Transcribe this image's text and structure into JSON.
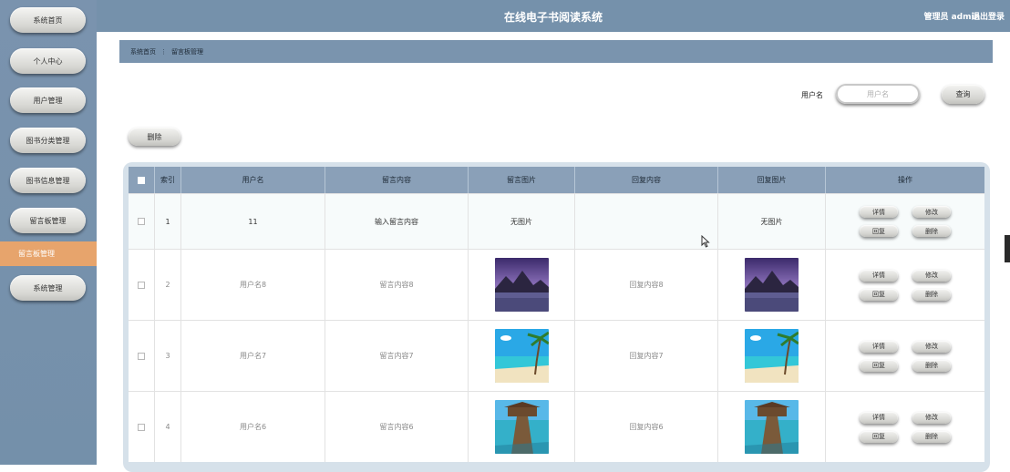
{
  "app": {
    "title": "在线电子书阅读系统",
    "user_info": "管理员 admin",
    "logout_label": "退出登录"
  },
  "sidebar": {
    "items": [
      {
        "label": "系统首页"
      },
      {
        "label": "个人中心"
      },
      {
        "label": "用户管理"
      },
      {
        "label": "图书分类管理"
      },
      {
        "label": "图书信息管理"
      },
      {
        "label": "留言板管理"
      },
      {
        "label": "留言板管理",
        "active": true
      },
      {
        "label": "系统管理"
      }
    ],
    "active_color": "#e7a46c"
  },
  "breadcrumb": {
    "home": "系统首页",
    "separator": "⋮",
    "current": "留言板管理"
  },
  "search": {
    "label": "用户名",
    "placeholder": "用户名",
    "value": "",
    "button_label": "查询"
  },
  "toolbar": {
    "delete_label": "删除"
  },
  "table": {
    "columns": [
      "",
      "索引",
      "用户名",
      "留言内容",
      "留言图片",
      "回复内容",
      "回复图片",
      "操作"
    ],
    "rows": [
      {
        "index": "1",
        "username": "11",
        "content": "输入留言内容",
        "image": "无图片",
        "reply": "",
        "reply_image": "无图片"
      },
      {
        "index": "2",
        "username": "用户名8",
        "content": "留言内容8",
        "image_kind": "lake",
        "reply": "回复内容8",
        "reply_image_kind": "lake"
      },
      {
        "index": "3",
        "username": "用户名7",
        "content": "留言内容7",
        "image_kind": "beach",
        "reply": "回复内容7",
        "reply_image_kind": "beach"
      },
      {
        "index": "4",
        "username": "用户名6",
        "content": "留言内容6",
        "image_kind": "pier",
        "reply": "回复内容6",
        "reply_image_kind": "pier"
      }
    ],
    "row_actions": [
      "详情",
      "修改",
      "回复",
      "删除"
    ]
  },
  "colors": {
    "header": "#7591ab",
    "sidebar": "#7a93ae",
    "table_header": "#8aa0b8"
  }
}
